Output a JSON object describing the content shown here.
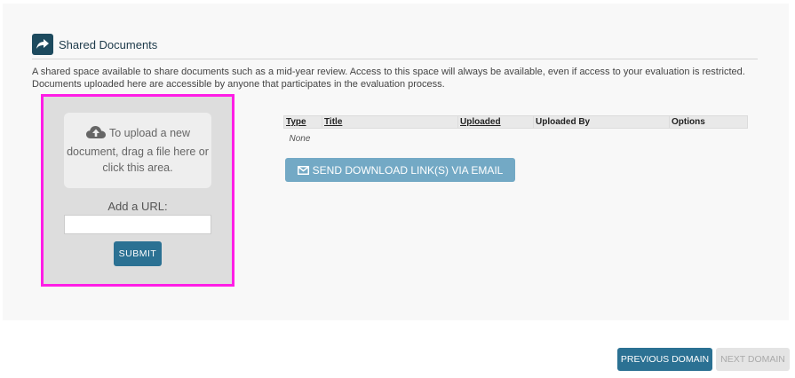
{
  "section": {
    "title": "Shared Documents",
    "icon": "share-arrow-icon",
    "description": "A shared space available to share documents such as a mid-year review. Access to this space will always be available, even if access to your evaluation is restricted. Documents uploaded here are accessible by anyone that participates in the evaluation process."
  },
  "upload": {
    "drop_text": "To upload a new document, drag a file here or click this area.",
    "cloud_icon": "cloud-upload-icon",
    "url_label": "Add a URL:",
    "url_value": "",
    "submit_label": "SUBMIT"
  },
  "table": {
    "columns": [
      "Type",
      "Title",
      "Uploaded",
      "Uploaded By",
      "Options"
    ],
    "empty_text": "None"
  },
  "email_button": {
    "label": "SEND DOWNLOAD LINK(S) VIA EMAIL",
    "icon": "envelope-icon"
  },
  "navigation": {
    "previous_label": "PREVIOUS DOMAIN",
    "next_label": "NEXT DOMAIN"
  },
  "colors": {
    "primary": "#2b7193",
    "email_button": "#73a9c5",
    "header_icon_bg": "#1d4a5e",
    "highlight_border": "#ff1de6"
  }
}
